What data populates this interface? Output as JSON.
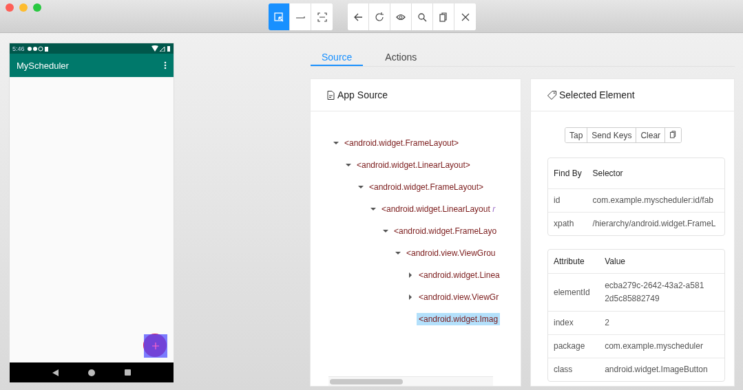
{
  "toolbar": {
    "modes": [
      {
        "kind": "select",
        "selected": true
      },
      {
        "kind": "swipe",
        "selected": false
      },
      {
        "kind": "tap-area",
        "selected": false
      }
    ],
    "actions": [
      {
        "kind": "back"
      },
      {
        "kind": "refresh"
      },
      {
        "kind": "eye"
      },
      {
        "kind": "search"
      },
      {
        "kind": "copy"
      },
      {
        "kind": "close"
      }
    ]
  },
  "device": {
    "status_time": "5:46",
    "app_title": "MyScheduler"
  },
  "tabs": [
    {
      "label": "Source",
      "selected": true
    },
    {
      "label": "Actions",
      "selected": false
    }
  ],
  "source_panel": {
    "title": "App Source",
    "tree": [
      {
        "tag": "<android.widget.FrameLayout>",
        "expanded": true,
        "children": [
          {
            "tag": "<android.widget.LinearLayout>",
            "expanded": true,
            "children": [
              {
                "tag": "<android.widget.FrameLayout>",
                "expanded": true,
                "children": [
                  {
                    "tag": "<android.widget.LinearLayout",
                    "attribute": "r",
                    "expanded": true,
                    "children": [
                      {
                        "tag": "<android.widget.FrameLayo",
                        "expanded": true,
                        "children": [
                          {
                            "tag": "<android.view.ViewGrou",
                            "expanded": true,
                            "children": [
                              {
                                "tag": "<android.widget.Linea",
                                "expanded": false
                              },
                              {
                                "tag": "<android.view.ViewGr",
                                "expanded": false
                              },
                              {
                                "tag": "<android.widget.Imag",
                                "selected": true
                              }
                            ]
                          }
                        ]
                      }
                    ]
                  }
                ]
              }
            ]
          }
        ]
      }
    ]
  },
  "element_panel": {
    "title": "Selected Element",
    "buttons": [
      "Tap",
      "Send Keys",
      "Clear"
    ],
    "selectors": {
      "columns": [
        "Find By",
        "Selector"
      ],
      "rows": [
        [
          "id",
          "com.example.myscheduler:id/fab"
        ],
        [
          "xpath",
          "/hierarchy/android.widget.FrameL"
        ]
      ]
    },
    "attributes": {
      "columns": [
        "Attribute",
        "Value"
      ],
      "rows": [
        [
          "elementId",
          "ecba279c-2642-43a2-a581\n2d5c85882749"
        ],
        [
          "index",
          "2"
        ],
        [
          "package",
          "com.example.myscheduler"
        ],
        [
          "class",
          "android.widget.ImageButton"
        ]
      ]
    }
  }
}
